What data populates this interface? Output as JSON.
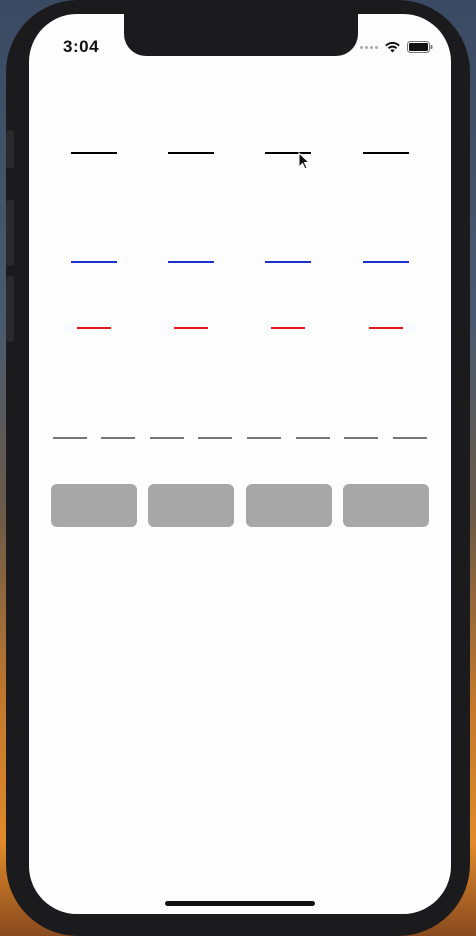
{
  "status_bar": {
    "time": "3:04",
    "wifi_icon": "wifi-icon",
    "battery_icon": "battery-icon"
  },
  "colors": {
    "black_line": "#000000",
    "blue_line": "#1a33cc",
    "red_line": "#e01b1b",
    "gray_line": "#777777",
    "gray_box": "#a7a7a7"
  },
  "rows": {
    "black_lines": 4,
    "blue_lines": 4,
    "red_lines": 4,
    "gray_lines": 8,
    "gray_boxes": 4
  }
}
